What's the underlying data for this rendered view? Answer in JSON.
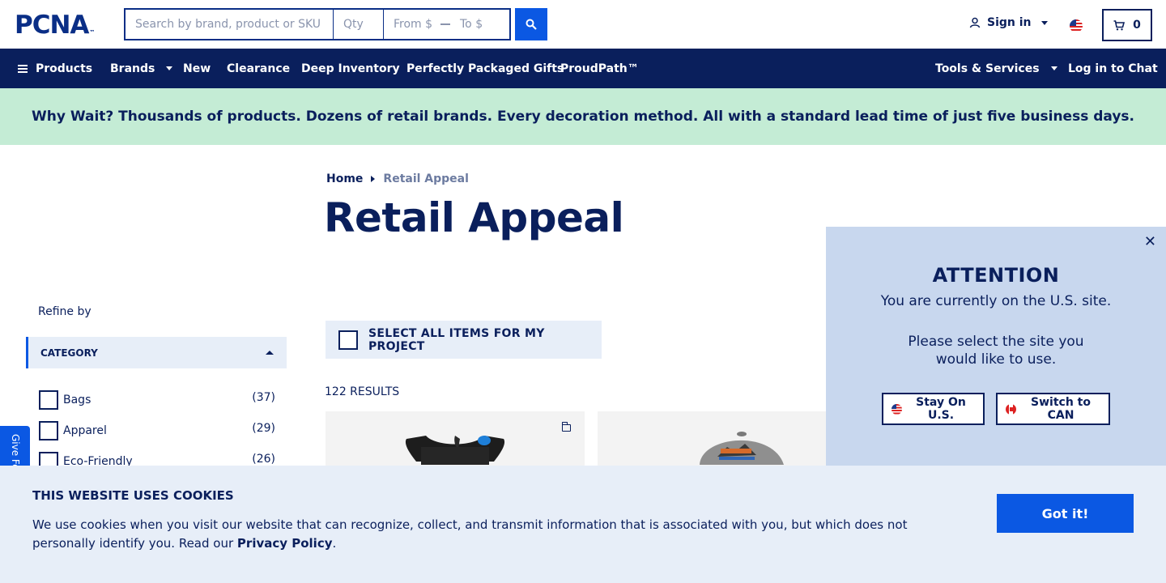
{
  "header": {
    "logo": "PCNA",
    "logo_tm": "™",
    "search": {
      "placeholder": "Search by brand, product or SKU",
      "qty_placeholder": "Qty",
      "from_placeholder": "From $",
      "to_placeholder": "To $"
    },
    "signin_label": "Sign in",
    "cart_count": "0"
  },
  "nav": {
    "items": [
      "Products",
      "Brands",
      "New",
      "Clearance",
      "Deep Inventory",
      "Perfectly Packaged Gifts",
      "ProudPath™"
    ],
    "tools_label": "Tools & Services",
    "chat_label": "Log in to Chat"
  },
  "banner": {
    "text": "Why Wait? Thousands of products. Dozens of retail brands. Every decoration method. All with a standard lead time of just five business days."
  },
  "breadcrumb": {
    "home": "Home",
    "current": "Retail Appeal"
  },
  "page_title": "Retail Appeal",
  "sidebar": {
    "refine_label": "Refine by",
    "category_label": "CATEGORY",
    "filters": [
      {
        "label": "Bags",
        "count": "(37)"
      },
      {
        "label": "Apparel",
        "count": "(29)"
      },
      {
        "label": "Eco-Friendly",
        "count": "(26)"
      }
    ],
    "feedback_label": "Give Feedback"
  },
  "main": {
    "select_all_label": "SELECT ALL ITEMS FOR MY PROJECT",
    "results_label": "122 RESULTS"
  },
  "attention": {
    "title": "ATTENTION",
    "line1": "You are currently on the U.S. site.",
    "line2": "Please select the site you would like to use.",
    "stay_label": "Stay On U.S.",
    "switch_label": "Switch to CAN"
  },
  "cookie": {
    "title": "THIS WEBSITE USES COOKIES",
    "text": "We use cookies when you visit our website that can recognize, collect, and transmit information that is associated with you, but which does not personally identify you. Read our",
    "link": "Privacy Policy",
    "period": ".",
    "button": "Got it!"
  },
  "colors": {
    "navy": "#0a1f5c",
    "brand_blue": "#0b58e3",
    "banner_green": "#c4ecd5",
    "light_blue": "#e7eef8",
    "popup_blue": "#c8d7ee"
  }
}
